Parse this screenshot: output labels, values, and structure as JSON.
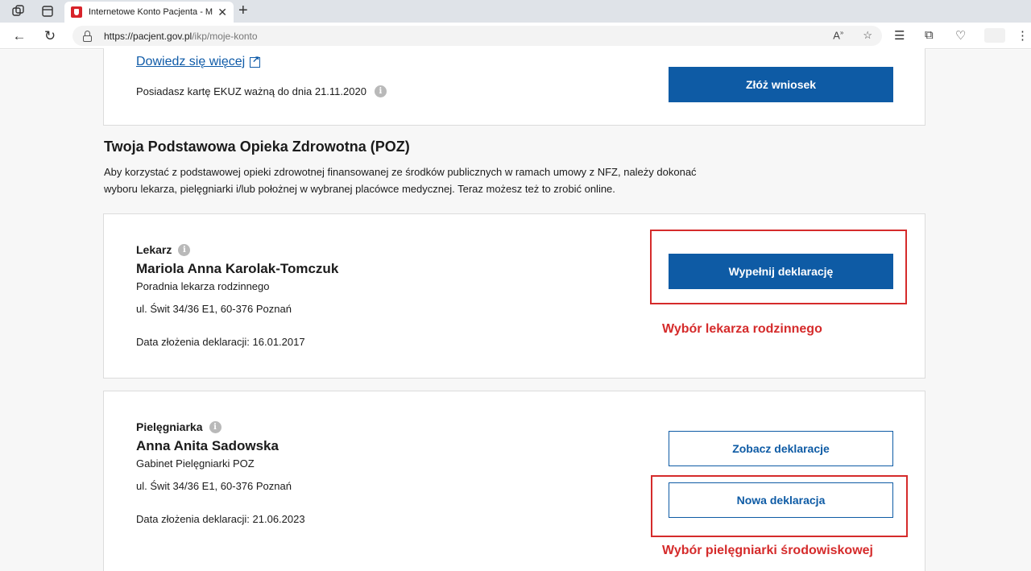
{
  "browser": {
    "tab_title": "Internetowe Konto Pacjenta - Mo",
    "url_host": "https://pacjent.gov.pl",
    "url_path": "/ikp/moje-konto"
  },
  "ekuz": {
    "link_label": "Dowiedz się więcej",
    "card_text": "Posiadasz kartę EKUZ ważną do dnia 21.11.2020",
    "apply_button": "Złóż wniosek"
  },
  "poz": {
    "title": "Twoja Podstawowa Opieka Zdrowotna (POZ)",
    "intro": "Aby korzystać z podstawowej opieki zdrowotnej finansowanej ze środków publicznych w ramach umowy z NFZ, należy dokonać wyboru lekarza, pielęgniarki i/lub położnej w wybranej placówce medycznej. Teraz możesz też to zrobić online."
  },
  "doctor": {
    "role": "Lekarz",
    "name": "Mariola Anna Karolak-Tomczuk",
    "place": "Poradnia lekarza rodzinnego",
    "address": "ul. Świt  34/36  E1,  60-376  Poznań",
    "date": "Data złożenia deklaracji: 16.01.2017",
    "button": "Wypełnij deklarację",
    "annotation": "Wybór lekarza rodzinnego"
  },
  "nurse": {
    "role": "Pielęgniarka",
    "name": "Anna Anita Sadowska",
    "place": "Gabinet Pielęgniarki POZ",
    "address": "ul. Świt  34/36  E1,  60-376  Poznań",
    "date": "Data złożenia deklaracji: 21.06.2023",
    "view_button": "Zobacz deklaracje",
    "new_button": "Nowa deklaracja",
    "annotation": "Wybór pielęgniarki środowiskowej"
  },
  "colors": {
    "primary": "#0e5ba5",
    "annotation": "#d52b2b"
  }
}
